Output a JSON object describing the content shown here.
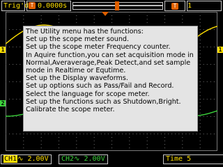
{
  "top_bar": {
    "trigger_state": "Trig'd",
    "trigger_time": "0.0000s",
    "trigger_time_icon": "T",
    "trigger_level_icon": "T",
    "top_right_text": "1"
  },
  "channels": {
    "ch1_marker": "1",
    "ch2_marker": "2",
    "ch1_right_marker": "1",
    "ch1_label": "CH1",
    "ch1_coupling_symbol": "∿",
    "ch1_scale": "2.00V",
    "ch2_label": "CH2",
    "ch2_coupling_symbol": "∿",
    "ch2_scale": "2.00V"
  },
  "time_status": "Time 5",
  "help_lines": [
    "The Utility menu has the functions:",
    "Set up the scope meter sound.",
    "Set up the scope meter Frequency counter.",
    "In Aquire function,you can set acquisition mode in Normal,Averaverage,Peak Detect,and set sample mode in Realtime or Equtime.",
    "Set up the Display waveforms.",
    "Set up options such as Pass/Fail and Record.",
    "Select the language for scope meter.",
    "Set up the functions such as Shutdown,Bright.",
    "Calibrate the scope meter."
  ],
  "colors": {
    "ch1": "#ffe000",
    "ch2": "#3cd23c",
    "trigger": "#e06000",
    "panel_bg": "#e4e4e4",
    "grid": "#7a7a7a"
  },
  "icons": {
    "trigger_time_icon": "trigger-t-icon",
    "trigger_level_icon": "trigger-t-icon",
    "trigger_position_icon": "triangle-down-icon"
  }
}
